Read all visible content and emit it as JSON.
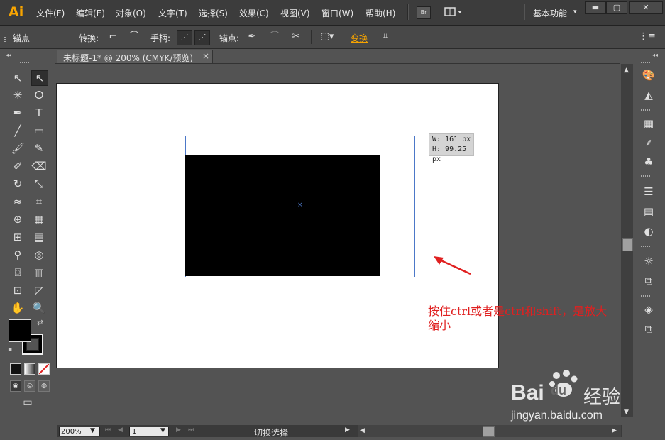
{
  "app": {
    "logo": "Ai"
  },
  "menu": {
    "items": [
      "文件(F)",
      "编辑(E)",
      "对象(O)",
      "文字(T)",
      "选择(S)",
      "效果(C)",
      "视图(V)",
      "窗口(W)",
      "帮助(H)"
    ],
    "bridge_label": "Br",
    "workspace": "基本功能"
  },
  "control_bar": {
    "anchor_label": "锚点",
    "convert_label": "转换:",
    "handles_label": "手柄:",
    "anchors_label": "锚点:",
    "transform_label": "变换"
  },
  "document": {
    "tab_title": "未标题-1* @ 200% (CMYK/预览)",
    "tab_close": "×"
  },
  "canvas": {
    "size_tooltip": {
      "width": "W: 161 px",
      "height": "H: 99.25 px"
    },
    "annotation_line1": "按住ctrl或者是ctrl和shift，是放大",
    "annotation_line2": "缩小",
    "arrow_color": "#e02020"
  },
  "status_bar": {
    "zoom": "200%",
    "page": "1",
    "status_text": "切换选择"
  },
  "watermark": {
    "brand_bai": "Bai",
    "brand_du": "du",
    "brand_cn": "经验",
    "url": "jingyan.baidu.com"
  },
  "colors": {
    "accent": "#f7a400",
    "selection": "#4c78c8",
    "fill": "#000000"
  }
}
